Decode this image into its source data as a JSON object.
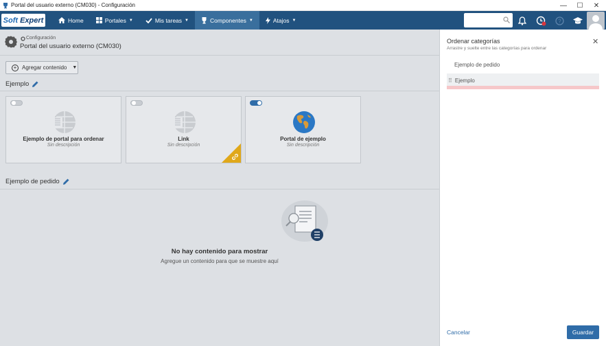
{
  "window": {
    "title": "Portal del usuario externo (CM030) - Configuración",
    "controls": {
      "minimize": "—",
      "maximize": "☐",
      "close": "✕"
    }
  },
  "navbar": {
    "logo_part1": "Soft",
    "logo_part2": "Expert",
    "items": [
      {
        "label": "Home",
        "icon": "home-icon"
      },
      {
        "label": "Portales",
        "icon": "grid-icon"
      },
      {
        "label": "Mis tareas",
        "icon": "check-icon"
      },
      {
        "label": "Componentes",
        "icon": "trophy-icon",
        "active": true
      },
      {
        "label": "Atajos",
        "icon": "bolt-icon"
      }
    ],
    "search_placeholder": "",
    "notification_badge": "1"
  },
  "header": {
    "breadcrumb": "Configuración",
    "title": "Portal del usuario externo (CM030)"
  },
  "toolbar": {
    "add_content_label": "Agregar contenido"
  },
  "sections": [
    {
      "title": "Ejemplo",
      "cards": [
        {
          "name": "Ejemplo de portal para ordenar",
          "desc": "Sin descripción",
          "enabled": false,
          "icon": "portal-placeholder-icon"
        },
        {
          "name": "Link",
          "desc": "Sin descripción",
          "enabled": false,
          "icon": "portal-placeholder-icon",
          "link_badge": true
        },
        {
          "name": "Portal de ejemplo",
          "desc": "Sin descripción",
          "enabled": true,
          "icon": "globe-icon"
        }
      ]
    },
    {
      "title": "Ejemplo de pedido",
      "empty": {
        "title": "No hay contenido para mostrar",
        "subtitle": "Agregue un contenido para que se muestre aquí"
      }
    }
  ],
  "panel": {
    "title": "Ordenar categorías",
    "subtitle": "Arrastre y suelte entre las categorías para ordenar",
    "categories": [
      "Ejemplo de pedido",
      "Ejemplo"
    ],
    "cancel_label": "Cancelar",
    "save_label": "Guardar"
  },
  "colors": {
    "navbar": "#21527f",
    "accent": "#2f6ca8",
    "link_badge": "#e0a81a",
    "drop_indicator": "#f6c7c9"
  }
}
